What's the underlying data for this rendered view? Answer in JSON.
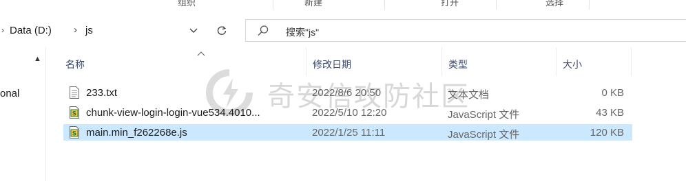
{
  "ribbon": {
    "groups": [
      "组织",
      "新建",
      "打开",
      "选择"
    ]
  },
  "address": {
    "breadcrumbs": [
      "Data (D:)",
      "js"
    ],
    "search_placeholder": "搜索\"js\""
  },
  "nav": {
    "items": [
      "onal"
    ]
  },
  "columns": {
    "name": "名称",
    "modified": "修改日期",
    "type": "类型",
    "size": "大小"
  },
  "files": [
    {
      "name": "233.txt",
      "modified": "2022/8/6 20:50",
      "type": "文本文档",
      "size": "0 KB",
      "icon": "text-file-icon"
    },
    {
      "name": "chunk-view-login-login-vue534.4010...",
      "modified": "2022/5/10 12:20",
      "type": "JavaScript 文件",
      "size": "43 KB",
      "icon": "js-file-icon"
    },
    {
      "name": "main.min_f262268e.js",
      "modified": "2022/1/25 11:11",
      "type": "JavaScript 文件",
      "size": "120 KB",
      "icon": "js-file-icon"
    }
  ],
  "watermark": {
    "text": "奇安信攻防社区"
  },
  "colors": {
    "selected_row": "#cce8ff",
    "header_text": "#3b4a6b"
  }
}
